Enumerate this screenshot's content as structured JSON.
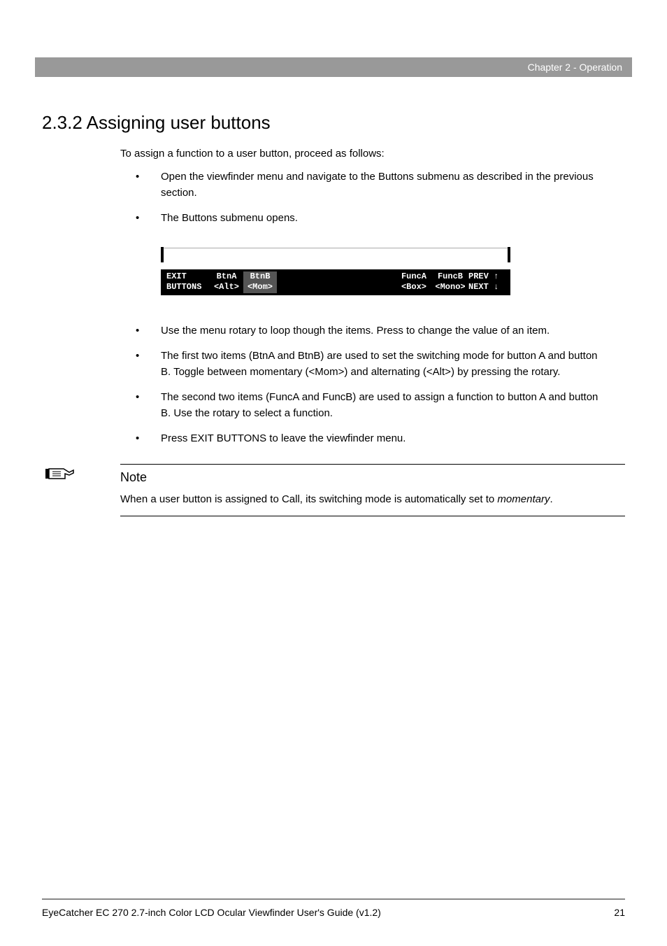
{
  "header": {
    "chapter_label": "Chapter 2 - Operation"
  },
  "section": {
    "number": "2.3.2",
    "title": "Assigning user buttons"
  },
  "intro": "To assign a function to a user button, proceed as follows:",
  "bullets_top": [
    "Open the viewfinder menu and navigate to the Buttons submenu as described in the previous section.",
    "The Buttons submenu opens."
  ],
  "menu": {
    "col1_top": "EXIT",
    "col1_bot": "BUTTONS",
    "col2_top": "BtnA",
    "col2_bot": "<Alt>",
    "col3_top": "BtnB",
    "col3_bot": "<Mom>",
    "col4_top": "FuncA",
    "col4_bot": "<Box>",
    "col5_top": "FuncB",
    "col5_bot": "<Mono>",
    "col6_top": "PREV ↑",
    "col6_bot": "NEXT ↓"
  },
  "bullets_bottom": [
    "Use the menu rotary to loop though the items. Press to change the value of an item.",
    "The first two items (BtnA and BtnB) are used to set the switching mode for button A and button B. Toggle between momentary (<Mom>) and alternating (<Alt>) by pressing the rotary.",
    "The second two items (FuncA and FuncB) are used to assign a function to button A and button B. Use the rotary to select a function.",
    "Press EXIT BUTTONS to leave the viewfinder menu."
  ],
  "note": {
    "title": "Note",
    "body_prefix": "When a user button is assigned to Call, its switching mode is automatically set to ",
    "body_italic": "momentary",
    "body_suffix": "."
  },
  "footer": {
    "doc_title": "EyeCatcher EC 270 2.7-inch Color LCD Ocular Viewfinder User's Guide (v1.2)",
    "page_number": "21"
  }
}
